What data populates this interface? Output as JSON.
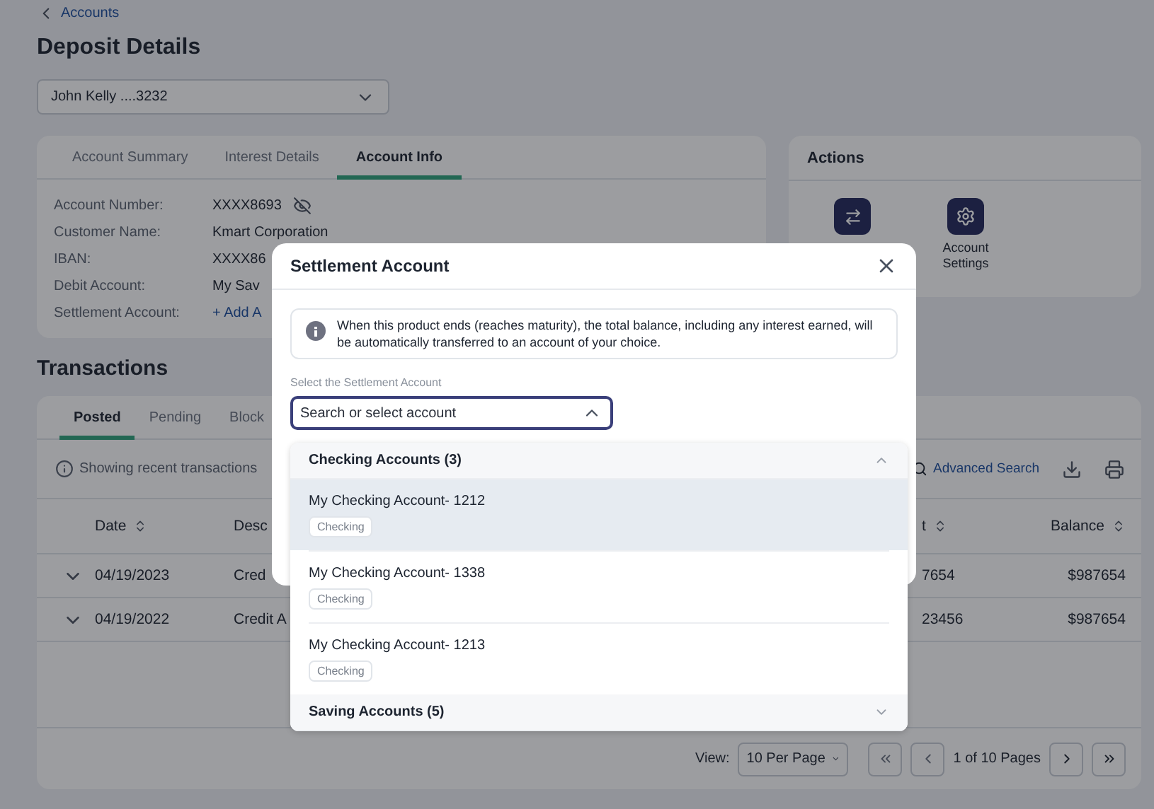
{
  "breadcrumb": {
    "label": "Accounts"
  },
  "title": "Deposit Details",
  "account_select": {
    "value": "John Kelly ....3232"
  },
  "account_card": {
    "tabs": [
      {
        "label": "Account Summary",
        "selected": false
      },
      {
        "label": "Interest Details",
        "selected": false
      },
      {
        "label": "Account Info",
        "selected": true
      }
    ],
    "fields": [
      {
        "label": "Account Number:",
        "value": "XXXX8693",
        "kind": "masked"
      },
      {
        "label": "Customer Name:",
        "value": "Kmart Corporation",
        "kind": "text"
      },
      {
        "label": "IBAN:",
        "value": "XXXX86",
        "kind": "text"
      },
      {
        "label": "Debit Account:",
        "value": "My Sav",
        "kind": "text"
      },
      {
        "label": "Settlement Account:",
        "value": "+ Add A",
        "kind": "link"
      }
    ]
  },
  "actions": {
    "title": "Actions",
    "buttons": [
      {
        "kind": "transfer"
      },
      {
        "kind": "settings",
        "label": "Account Settings"
      }
    ]
  },
  "transactions": {
    "title": "Transactions",
    "tabs": [
      {
        "label": "Posted",
        "selected": true
      },
      {
        "label": "Pending",
        "selected": false
      },
      {
        "label": "Block",
        "selected": false
      }
    ],
    "notice": "Showing recent transactions",
    "advanced_search": "Advanced Search",
    "columns": [
      {
        "label": "Date",
        "sortable": true
      },
      {
        "label": "Desc",
        "sortable": false
      },
      {
        "label": "t",
        "sortable": true
      },
      {
        "label": "Balance",
        "sortable": true
      }
    ],
    "rows": [
      {
        "date": "04/19/2023",
        "description": "Cred",
        "amount": "7654",
        "balance": "$987654",
        "expanded": false
      },
      {
        "date": "04/19/2022",
        "description": "Credit A",
        "amount": "23456",
        "balance": "$987654",
        "expanded": false
      }
    ],
    "pagination": {
      "view_label": "View:",
      "per_page": "10 Per Page",
      "pages": "1 of 10 Pages"
    }
  },
  "modal": {
    "title": "Settlement Account",
    "info": "When this product ends (reaches maturity), the total balance, including any interest earned, will be automatically transferred to an account of your choice.",
    "field_label": "Select the Settlement Account",
    "placeholder": "Search or select account",
    "groups": [
      {
        "title": "Checking Accounts (3)",
        "expanded": true,
        "items": [
          {
            "name": "My Checking Account- 1212",
            "tag": "Checking",
            "highlighted": true
          },
          {
            "name": "My Checking Account- 1338",
            "tag": "Checking",
            "highlighted": false
          },
          {
            "name": "My Checking Account- 1213",
            "tag": "Checking",
            "highlighted": false
          }
        ]
      },
      {
        "title": "Saving Accounts (5)",
        "expanded": false
      }
    ]
  }
}
